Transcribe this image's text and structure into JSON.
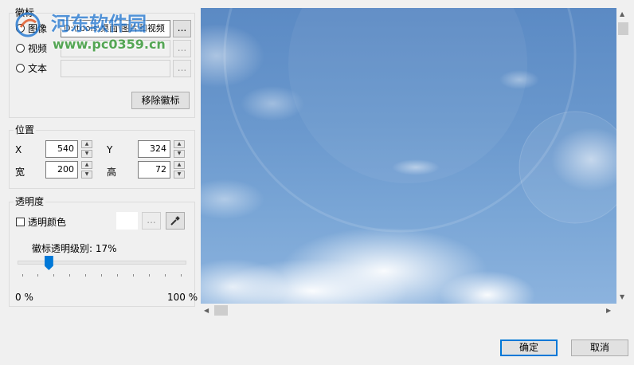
{
  "watermark_group": {
    "title": "徽标",
    "opt_image": "图像",
    "image_path": "D:\\tools\\桌面\\图片和视频",
    "opt_video": "视频",
    "opt_text": "文本",
    "browse": "...",
    "remove": "移除徽标"
  },
  "overlay_logo": {
    "site": "河东软件园",
    "url": "www.pc0359.cn"
  },
  "position_group": {
    "title": "位置",
    "x_label": "X",
    "x_value": "540",
    "y_label": "Y",
    "y_value": "324",
    "w_label": "宽",
    "w_value": "200",
    "h_label": "高",
    "h_value": "72"
  },
  "opacity_group": {
    "title": "透明度",
    "transparent_color_label": "透明颜色",
    "browse": "...",
    "level_label": "徽标透明级别: 17%",
    "level_fraction": 0.17,
    "min_label": "0 %",
    "max_label": "100 %"
  },
  "footer": {
    "ok": "确定",
    "cancel": "取消"
  },
  "colors": {
    "accent": "#0078d7",
    "sky": "#6a98cd"
  }
}
